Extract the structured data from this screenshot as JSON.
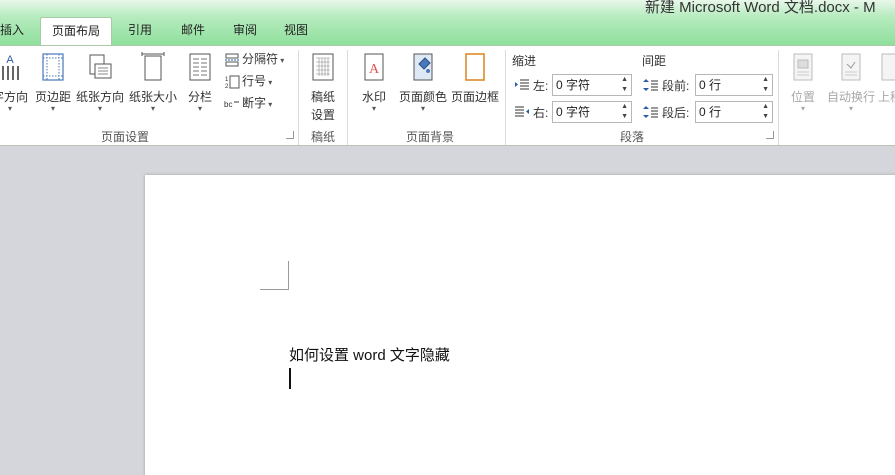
{
  "window": {
    "title": "新建 Microsoft Word 文档.docx - M"
  },
  "tabs": [
    {
      "label": "插入"
    },
    {
      "label": "页面布局"
    },
    {
      "label": "引用"
    },
    {
      "label": "邮件"
    },
    {
      "label": "审阅"
    },
    {
      "label": "视图"
    }
  ],
  "ribbon": {
    "page_setup": {
      "label": "页面设置",
      "text_direction": "字方向",
      "margins": "页边距",
      "orientation": "纸张方向",
      "size": "纸张大小",
      "columns": "分栏",
      "breaks": "分隔符",
      "line_numbers": "行号",
      "hyphenation": "断字"
    },
    "manuscript": {
      "label": "稿纸",
      "settings_line1": "稿纸",
      "settings_line2": "设置"
    },
    "background": {
      "label": "页面背景",
      "watermark": "水印",
      "page_color": "页面颜色",
      "page_borders": "页面边框"
    },
    "paragraph": {
      "label": "段落",
      "indent_title": "缩进",
      "spacing_title": "间距",
      "left_label": "左:",
      "left_value": "0 字符",
      "right_label": "右:",
      "right_value": "0 字符",
      "before_label": "段前:",
      "before_value": "0 行",
      "after_label": "段后:",
      "after_value": "0 行"
    },
    "arrange": {
      "position": "位置",
      "wrap_text": "自动换行",
      "bring_forward": "上移"
    }
  },
  "document": {
    "text": "如何设置 word 文字隐藏"
  },
  "colors": {
    "ribbon_green": "#8fdf9c",
    "document_bg": "#d4d6db"
  }
}
